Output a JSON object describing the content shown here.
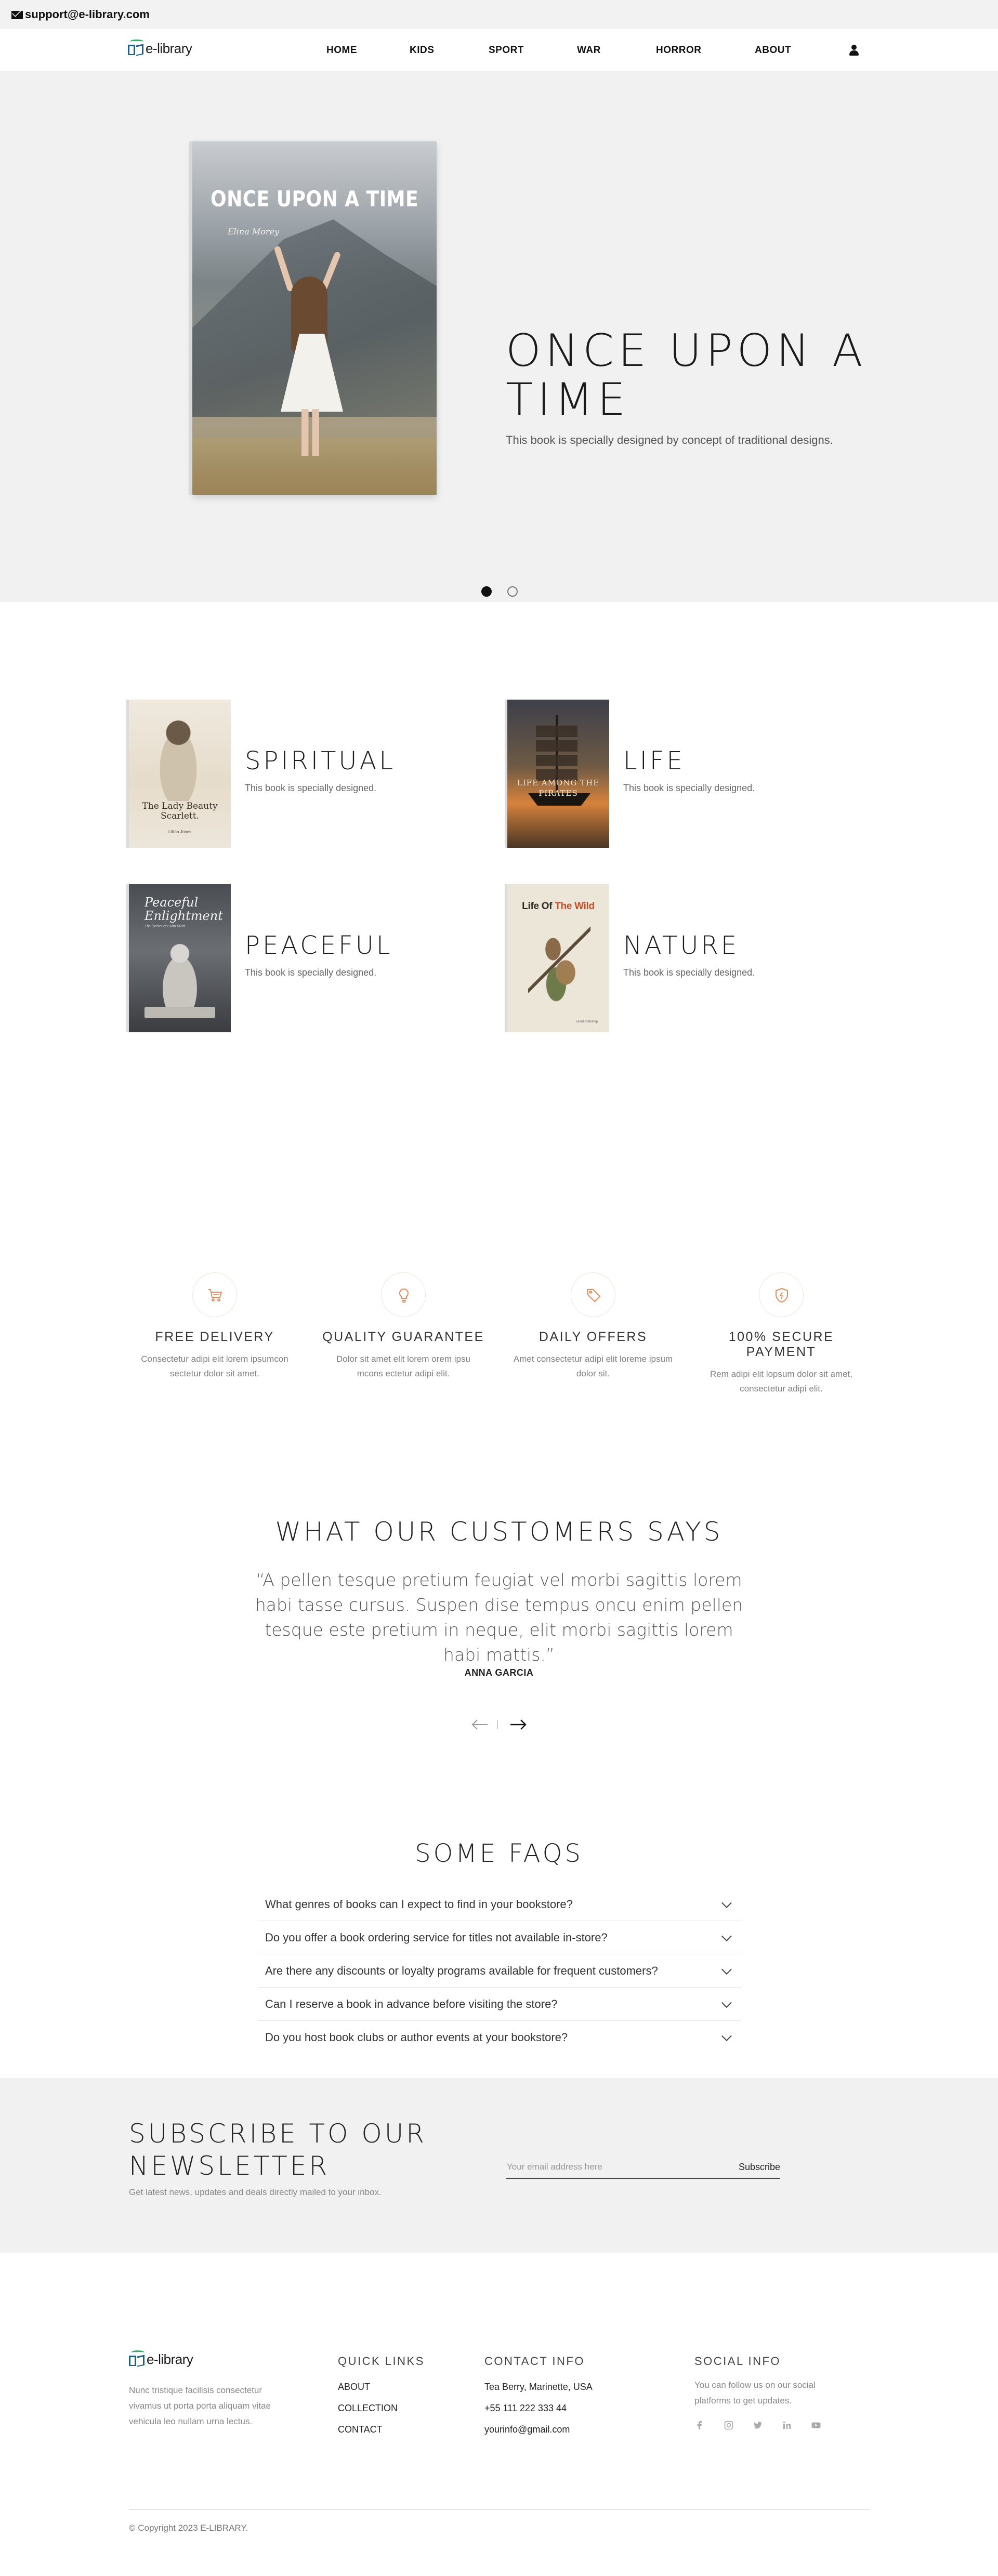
{
  "topbar": {
    "email": "support@e-library.com"
  },
  "brand": {
    "logo_text": "e-library"
  },
  "nav": {
    "items": [
      "HOME",
      "KIDS",
      "SPORT",
      "WAR",
      "HORROR",
      "ABOUT"
    ]
  },
  "hero": {
    "book_cover_title": "ONCE UPON A TIME",
    "book_cover_author": "Elina Morey",
    "title": "ONCE UPON A TIME",
    "subtitle": "This book is specially designed by concept of traditional designs.",
    "slides": 2,
    "active_slide": 1
  },
  "categories": [
    {
      "name": "SPIRITUAL",
      "desc": "This book is specially designed.",
      "cover_title": "The Lady Beauty Scarlett.",
      "cover_sub": "Lillian Jones"
    },
    {
      "name": "LIFE",
      "desc": "This book is specially designed.",
      "cover_title": "LIFE AMONG THE PIRATES"
    },
    {
      "name": "PEACEFUL",
      "desc": "This book is specially designed.",
      "cover_title": "Peaceful Enlightment",
      "cover_sub": "The Secret of Calm Mind"
    },
    {
      "name": "NATURE",
      "desc": "This book is specially designed.",
      "cover_title_a": "Life Of ",
      "cover_title_b": "The Wild",
      "cover_sub": "Leonard Bishop"
    }
  ],
  "features": [
    {
      "icon": "cart-icon",
      "title": "FREE DELIVERY",
      "desc": "Consectetur adipi elit lorem ipsumcon sectetur dolor sit amet."
    },
    {
      "icon": "lightbulb-icon",
      "title": "QUALITY GUARANTEE",
      "desc": "Dolor sit amet elit lorem orem ipsu mcons ectetur adipi elit."
    },
    {
      "icon": "tag-icon",
      "title": "DAILY OFFERS",
      "desc": "Amet consectetur adipi elit loreme ipsum dolor sit."
    },
    {
      "icon": "shield-icon",
      "title": "100% SECURE PAYMENT",
      "desc": "Rem adipi elit lopsum dolor sit amet, consectetur adipi elit."
    }
  ],
  "accent_color": "#e38c5a",
  "testimonial": {
    "title": "WHAT OUR CUSTOMERS SAYS",
    "quote": "“A pellen tesque pretium feugiat vel morbi sagittis lorem habi tasse cursus. Suspen dise tempus oncu enim pellen tesque este pretium in neque, elit morbi sagittis lorem habi mattis.”",
    "author": "ANNA GARCIA"
  },
  "faq": {
    "title": "SOME FAQS",
    "items": [
      "What genres of books can I expect to find in your bookstore?",
      "Do you offer a book ordering service for titles not available in-store?",
      "Are there any discounts or loyalty programs available for frequent customers?",
      "Can I reserve a book in advance before visiting the store?",
      "Do you host book clubs or author events at your bookstore?"
    ]
  },
  "subscribe": {
    "title": "SUBSCRIBE TO OUR NEWSLETTER",
    "subtitle": "Get latest news, updates and deals directly mailed to your inbox.",
    "placeholder": "Your email address here",
    "button": "Subscribe"
  },
  "footer": {
    "about": "Nunc tristique facilisis consectetur vivamus ut porta porta aliquam vitae vehicula leo nullam urna lectus.",
    "quick_links": {
      "heading": "QUICK LINKS",
      "items": [
        "ABOUT",
        "COLLECTION",
        "CONTACT"
      ]
    },
    "contact": {
      "heading": "CONTACT INFO",
      "items": [
        "Tea Berry, Marinette, USA",
        "+55 111 222 333 44",
        "yourinfo@gmail.com"
      ]
    },
    "social": {
      "heading": "SOCIAL INFO",
      "text": "You can follow us on our social platforms to get updates.",
      "icons": [
        "facebook-icon",
        "instagram-icon",
        "twitter-icon",
        "linkedin-icon",
        "youtube-icon"
      ]
    },
    "copyright": "© Copyright 2023 E-LIBRARY."
  }
}
